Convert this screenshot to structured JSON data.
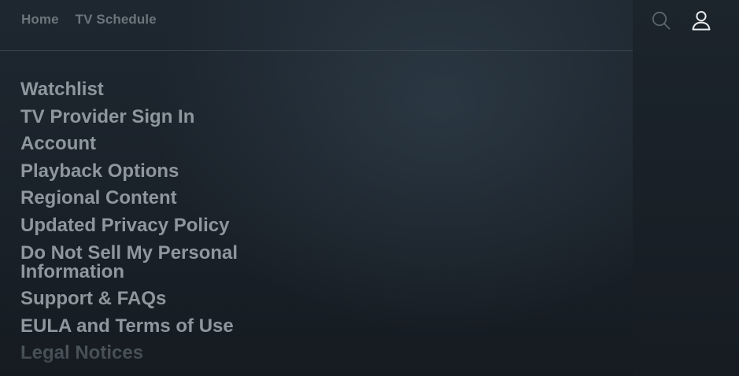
{
  "nav": {
    "home": "Home",
    "tv_schedule": "TV Schedule"
  },
  "header_icons": {
    "search": "search-icon",
    "profile": "profile-icon"
  },
  "menu": {
    "items": [
      {
        "label": "Watchlist"
      },
      {
        "label": "TV Provider Sign In"
      },
      {
        "label": "Account"
      },
      {
        "label": "Playback Options"
      },
      {
        "label": "Regional Content"
      },
      {
        "label": "Updated Privacy Policy"
      },
      {
        "label_line1": "Do Not Sell My Personal",
        "label_line2": "Information"
      },
      {
        "label": "Support & FAQs"
      },
      {
        "label": "EULA and Terms of Use"
      },
      {
        "label": "Legal Notices"
      }
    ]
  },
  "colors": {
    "background": "#1b232b",
    "menu_text": "#8e979e",
    "nav_text": "#6c757c",
    "faded_text": "#59636b"
  }
}
